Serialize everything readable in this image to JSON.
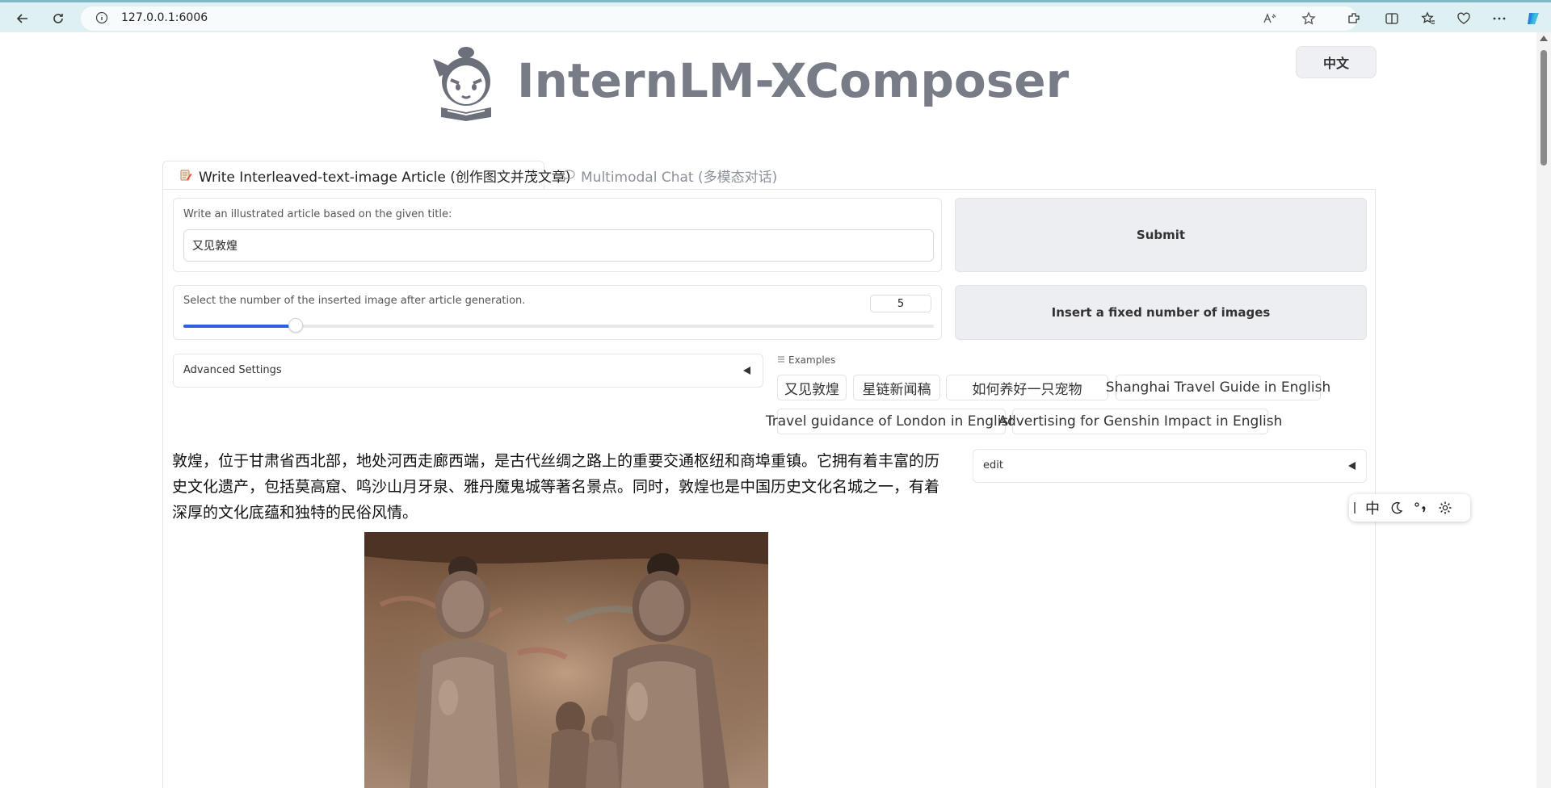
{
  "browser": {
    "url": "127.0.0.1:6006"
  },
  "header": {
    "title": "InternLM-XComposer",
    "lang_button": "中文"
  },
  "tabs": [
    {
      "label": "Write Interleaved-text-image Article (创作图文并茂文章)"
    },
    {
      "label": "Multimodal Chat (多模态对话)"
    }
  ],
  "title_input": {
    "label": "Write an illustrated article based on the given title:",
    "value": "又见敦煌"
  },
  "image_count": {
    "label": "Select the number of the inserted image after article generation.",
    "value": "5",
    "slider_fraction": 0.15
  },
  "buttons": {
    "submit": "Submit",
    "insert_fixed": "Insert a fixed number of images"
  },
  "advanced_settings": {
    "label": "Advanced Settings"
  },
  "examples": {
    "label": "Examples",
    "items": [
      "又见敦煌",
      "星链新闻稿",
      "如何养好一只宠物",
      "Shanghai Travel Guide in English",
      "Travel guidance of London in English",
      "Advertising for Genshin Impact in English"
    ]
  },
  "article": {
    "paragraph": "敦煌，位于甘肃省西北部，地处河西走廊西端，是古代丝绸之路上的重要交通枢纽和商埠重镇。它拥有着丰富的历史文化遗产，包括莫高窟、鸣沙山月牙泉、雅丹魔鬼城等著名景点。同时，敦煌也是中国历史文化名城之一，有着深厚的文化底蕴和独特的民俗风情。"
  },
  "edit_panel": {
    "label": "edit"
  },
  "ime_toolbar": {
    "mode": "中"
  },
  "colors": {
    "accent": "#2f5fe0",
    "title": "#777c87",
    "browser_bar": "#dff0f3"
  }
}
